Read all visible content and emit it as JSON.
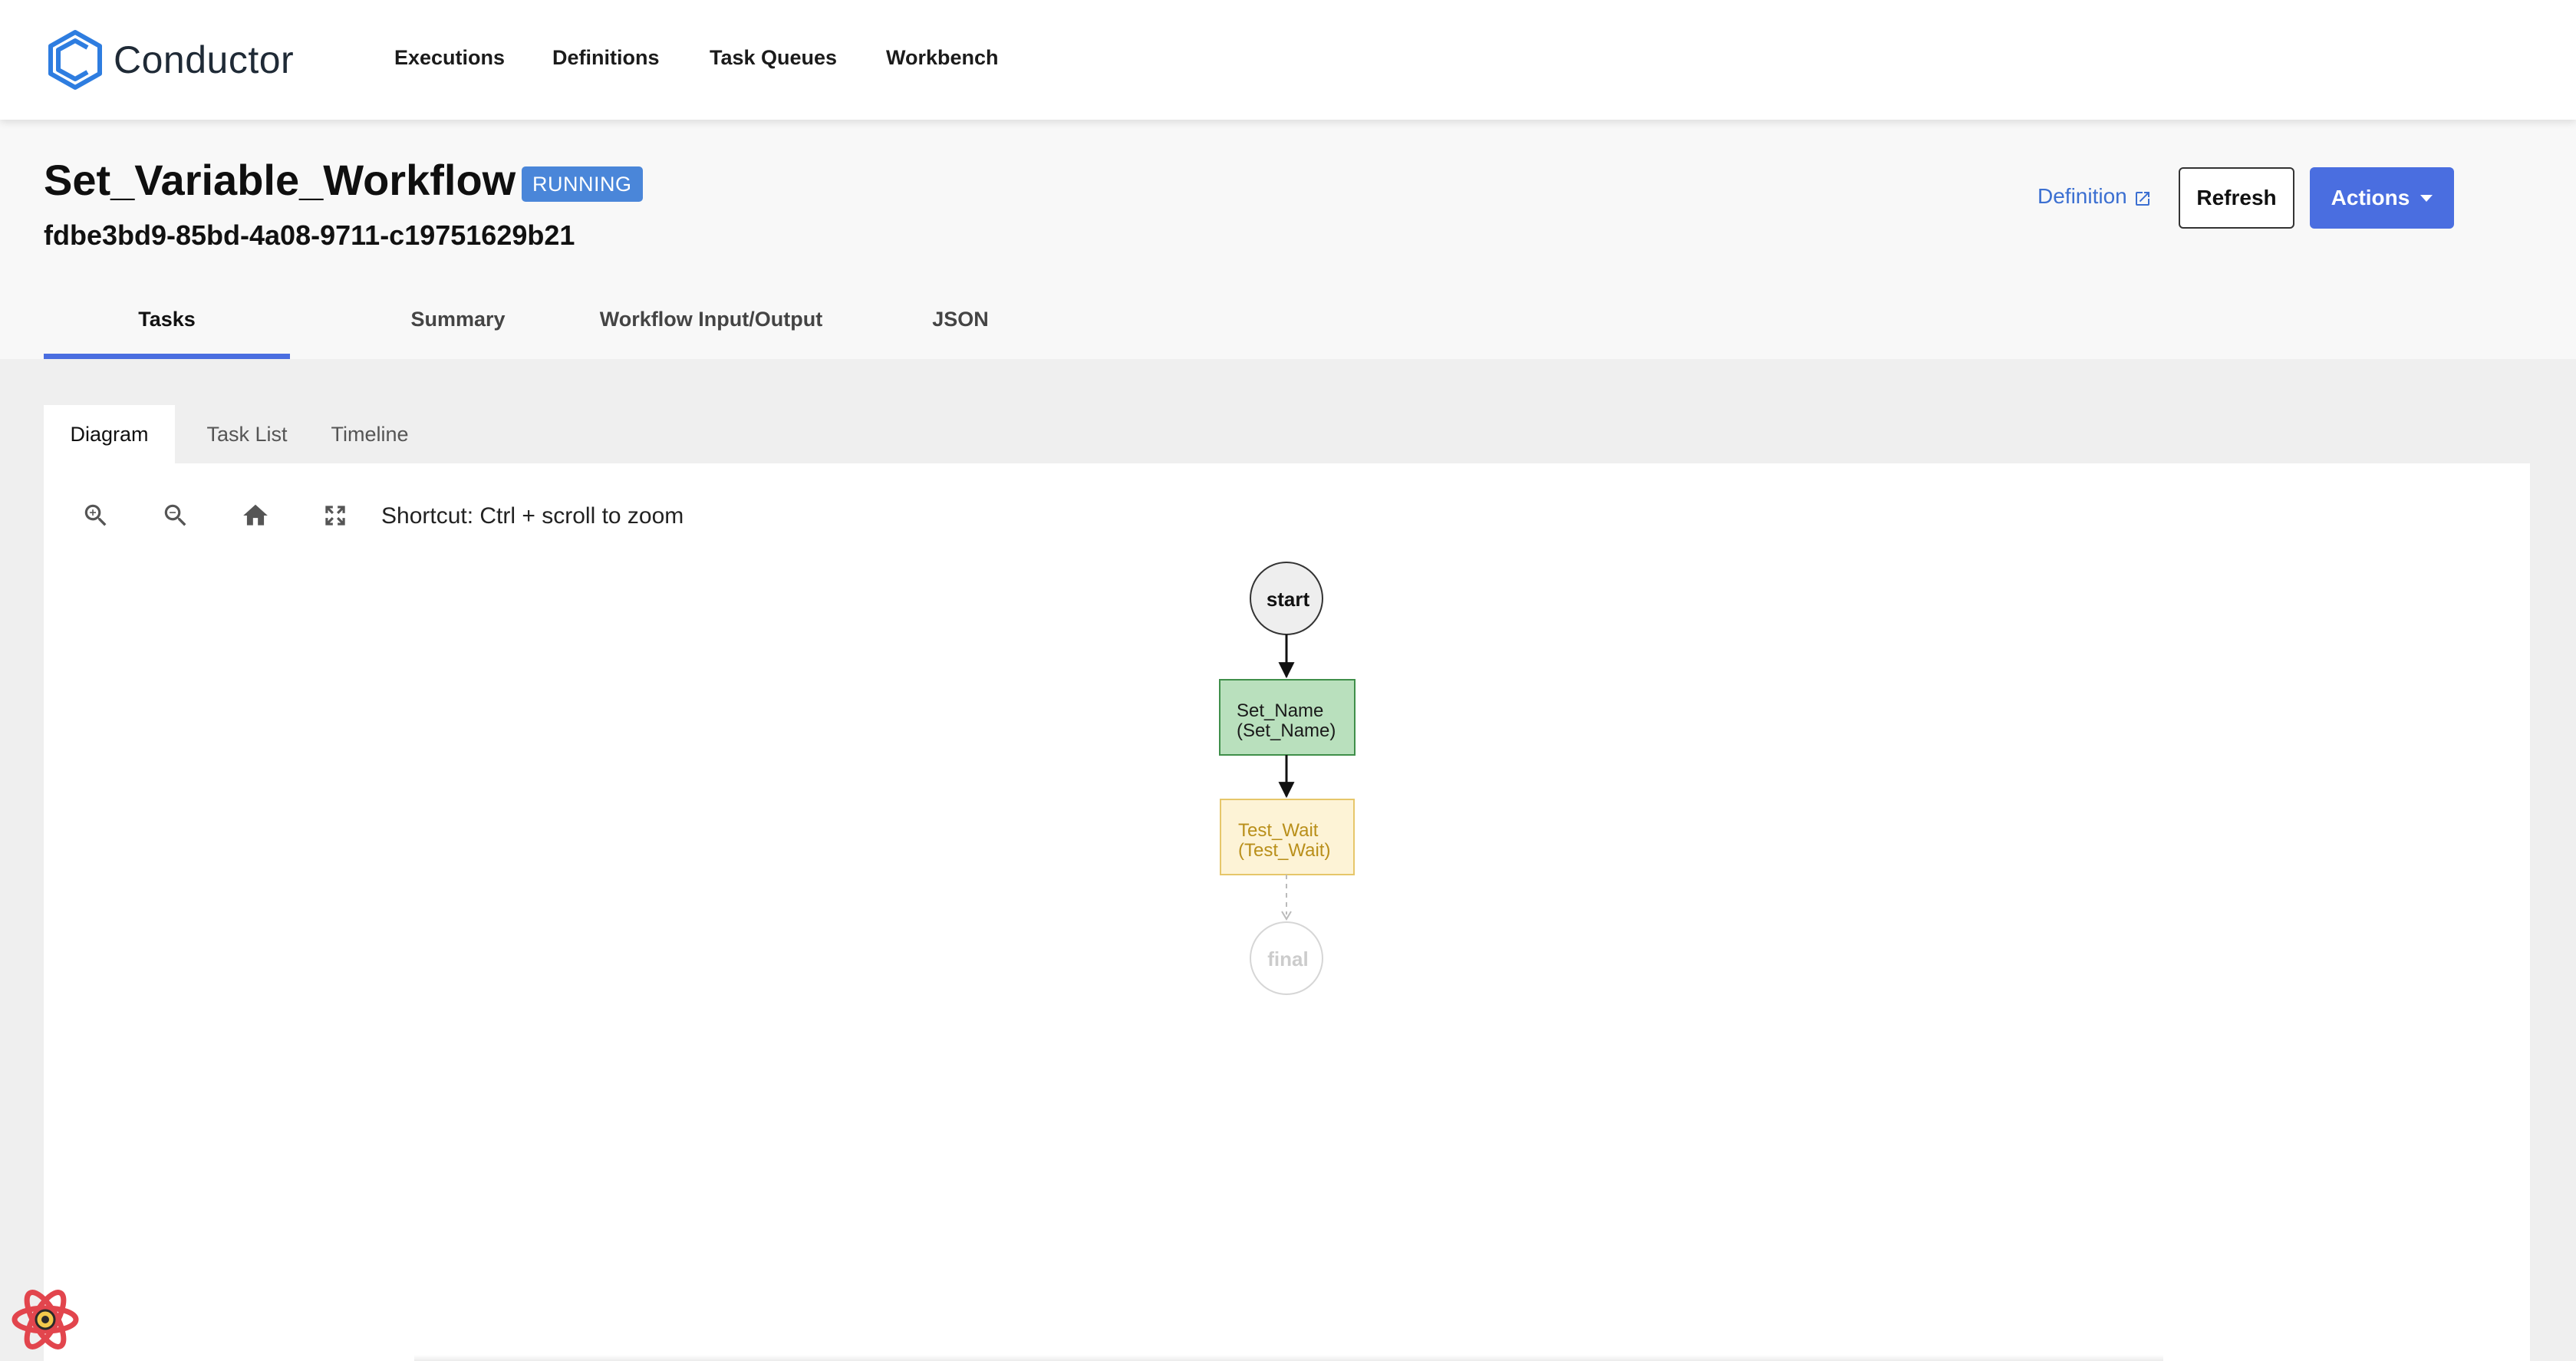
{
  "app": {
    "name": "Conductor"
  },
  "nav": {
    "items": [
      {
        "label": "Executions"
      },
      {
        "label": "Definitions"
      },
      {
        "label": "Task Queues"
      },
      {
        "label": "Workbench"
      }
    ]
  },
  "workflow": {
    "name": "Set_Variable_Workflow",
    "status": "RUNNING",
    "id": "fdbe3bd9-85bd-4a08-9711-c19751629b21"
  },
  "actions": {
    "definition_label": "Definition",
    "refresh_label": "Refresh",
    "actions_label": "Actions"
  },
  "tabs": [
    {
      "label": "Tasks",
      "active": true
    },
    {
      "label": "Summary",
      "active": false
    },
    {
      "label": "Workflow Input/Output",
      "active": false
    },
    {
      "label": "JSON",
      "active": false
    }
  ],
  "subtabs": [
    {
      "label": "Diagram",
      "active": true
    },
    {
      "label": "Task List",
      "active": false
    },
    {
      "label": "Timeline",
      "active": false
    }
  ],
  "toolbar": {
    "zoom_in_icon": "zoom-in-icon",
    "zoom_out_icon": "zoom-out-icon",
    "home_icon": "home-icon",
    "fullscreen_icon": "fullscreen-icon",
    "shortcut_text": "Shortcut: Ctrl + scroll to zoom"
  },
  "diagram": {
    "start_label": "start",
    "final_label": "final",
    "tasks": [
      {
        "line1": "Set_Name",
        "line2": "(Set_Name)",
        "status": "completed"
      },
      {
        "line1": "Test_Wait",
        "line2": "(Test_Wait)",
        "status": "in-progress"
      }
    ]
  },
  "colors": {
    "accent": "#4a6ee0",
    "badge": "#4a86d9",
    "link": "#3b6fd1",
    "completed_fill": "#b9e0bd",
    "completed_stroke": "#3f8f4a",
    "in_progress_fill": "#fdf3d6",
    "in_progress_stroke": "#e6c66a",
    "in_progress_text": "#b98f1a"
  }
}
